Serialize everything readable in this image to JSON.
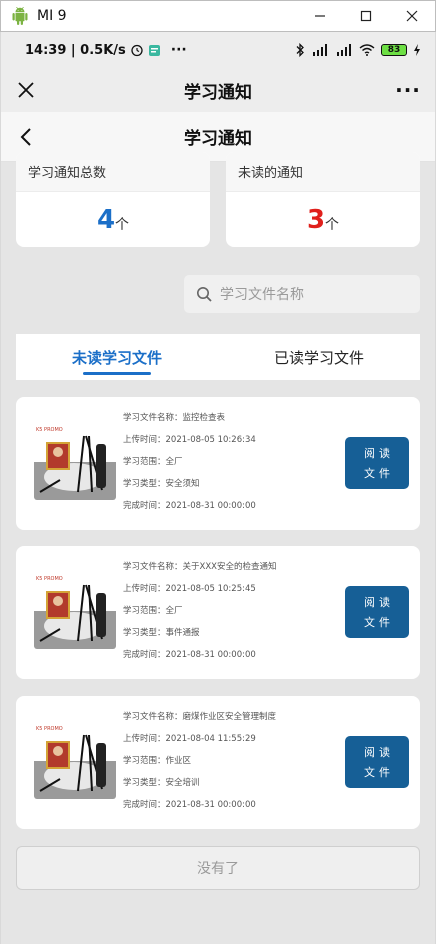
{
  "window": {
    "title": "MI 9",
    "controls": {
      "minimize": "—",
      "maximize": "☐",
      "close": "✕"
    }
  },
  "status_bar": {
    "time_speed": "14:39 | 0.5K/s",
    "more": "···",
    "battery": "83"
  },
  "wx_header": {
    "title": "学习通知",
    "more": "···"
  },
  "page_header": {
    "title": "学习通知"
  },
  "stats": {
    "total": {
      "label": "学习通知总数",
      "value": "4",
      "unit": "个",
      "color": "#1b6fc8"
    },
    "unread": {
      "label": "未读的通知",
      "value": "3",
      "unit": "个",
      "color": "#e0201c"
    }
  },
  "search": {
    "placeholder": "学习文件名称"
  },
  "tabs": [
    {
      "label": "未读学习文件",
      "active": true
    },
    {
      "label": "已读学习文件",
      "active": false
    }
  ],
  "cards": [
    {
      "name": "学习文件名称：监控检查表",
      "upload": "上传时间：2021-08-05 10:26:34",
      "scope": "学习范围：全厂",
      "type": "学习类型：安全须知",
      "finish": "完成时间：2021-08-31 00:00:00",
      "btn_line1": "阅读",
      "btn_line2": "文件"
    },
    {
      "name": "学习文件名称：关于XXX安全的检查通知",
      "upload": "上传时间：2021-08-05 10:25:45",
      "scope": "学习范围：全厂",
      "type": "学习类型：事件通报",
      "finish": "完成时间：2021-08-31 00:00:00",
      "btn_line1": "阅读",
      "btn_line2": "文件"
    },
    {
      "name": "学习文件名称：磨煤作业区安全管理制度",
      "upload": "上传时间：2021-08-04 11:55:29",
      "scope": "学习范围：作业区",
      "type": "学习类型：安全培训",
      "finish": "完成时间：2021-08-31 00:00:00",
      "btn_line1": "阅读",
      "btn_line2": "文件"
    }
  ],
  "footer": {
    "no_more": "没有了"
  },
  "colors": {
    "accent": "#1b6fc8",
    "button": "#165f96",
    "unread": "#e0201c"
  }
}
